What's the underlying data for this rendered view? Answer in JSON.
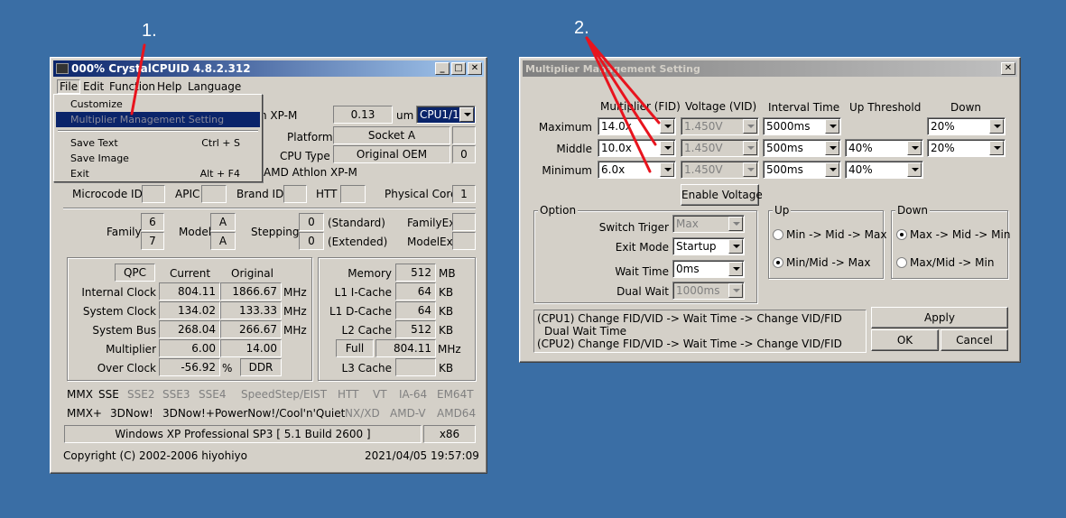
{
  "annotations": {
    "step1": "1.",
    "step2": "2."
  },
  "crystalcpuid": {
    "title": "000% CrystalCPUID 4.8.2.312",
    "menubar": [
      "File",
      "Edit",
      "Function",
      "Help",
      "Language"
    ],
    "file_menu": {
      "customize": "Customize",
      "multiplier": "Multiplier Management Setting",
      "save_text": "Save Text",
      "save_text_sc": "Ctrl + S",
      "save_image": "Save Image",
      "exit": "Exit",
      "exit_sc": "Alt + F4"
    },
    "name_partial": "n XP-M",
    "ghz": "0.13",
    "um": "um",
    "cpu_select": "CPU1/1",
    "platform_label": "Platform",
    "platform": "Socket A",
    "cputype_label": "CPU Type",
    "cputype": "Original OEM",
    "cputype_num": "0",
    "cpu_name": "AMD Athlon XP-M",
    "microcode_label": "Microcode ID",
    "apic_label": "APIC",
    "brand_label": "Brand ID",
    "htt_label": "HTT",
    "physcore_label": "Physical Core",
    "physcore": "1",
    "family_label": "Family",
    "family": "6",
    "family2": "7",
    "model_label": "Model",
    "model": "A",
    "model2": "A",
    "stepping_label": "Stepping",
    "stepping": "0",
    "stepping2": "0",
    "standard": "(Standard)",
    "extended": "(Extended)",
    "familyex_label": "FamilyEx",
    "modelex_label": "ModelEx",
    "clock": {
      "qpc": "QPC",
      "current": "Current",
      "original": "Original",
      "rows": [
        {
          "label": "Internal Clock",
          "cur": "804.11",
          "orig": "1866.67",
          "unit": "MHz"
        },
        {
          "label": "System Clock",
          "cur": "134.02",
          "orig": "133.33",
          "unit": "MHz"
        },
        {
          "label": "System Bus",
          "cur": "268.04",
          "orig": "266.67",
          "unit": "MHz"
        },
        {
          "label": "Multiplier",
          "cur": "6.00",
          "orig": "14.00",
          "unit": ""
        },
        {
          "label": "Over Clock",
          "cur": "-56.92",
          "orig": "DDR",
          "unit": "%"
        }
      ]
    },
    "memory": {
      "memory_label": "Memory",
      "memory": "512",
      "memory_unit": "MB",
      "l1i_label": "L1 I-Cache",
      "l1i": "64",
      "l1i_unit": "KB",
      "l1d_label": "L1 D-Cache",
      "l1d": "64",
      "l1d_unit": "KB",
      "l2_label": "L2 Cache",
      "l2": "512",
      "l2_unit": "KB",
      "full": "Full",
      "full_val": "804.11",
      "full_unit": "MHz",
      "l3_label": "L3 Cache",
      "l3_unit": "KB"
    },
    "features1": [
      "MMX",
      "SSE",
      "SSE2",
      "SSE3",
      "SSE4",
      "SpeedStep/EIST",
      "HTT",
      "VT",
      "IA-64",
      "EM64T"
    ],
    "features2": [
      "MMX+",
      "3DNow!",
      "3DNow!+",
      "PowerNow!/Cool'n'Quiet",
      "NX/XD",
      "AMD-V",
      "AMD64"
    ],
    "os": "Windows XP Professional SP3 [ 5.1 Build 2600 ]",
    "arch": "x86",
    "copyright": "Copyright (C) 2002-2006 hiyohiyo",
    "datetime": "2021/04/05 19:57:09"
  },
  "mms": {
    "title": "Multiplier Management Setting",
    "col_fid": "Multiplier (FID)",
    "col_vid": "Voltage (VID)",
    "col_interval": "Interval Time",
    "col_up": "Up Threshold",
    "col_down": "Down",
    "rows": [
      {
        "label": "Maximum",
        "fid": "14.0x",
        "vid": "1.450V",
        "interval": "5000ms",
        "up": "",
        "down": "20%"
      },
      {
        "label": "Middle",
        "fid": "10.0x",
        "vid": "1.450V",
        "interval": "500ms",
        "up": "40%",
        "down": "20%"
      },
      {
        "label": "Minimum",
        "fid": "6.0x",
        "vid": "1.450V",
        "interval": "500ms",
        "up": "40%",
        "down": ""
      }
    ],
    "enable_voltage": "Enable Voltage",
    "option_label": "Option",
    "switch_label": "Switch Triger",
    "switch": "Max",
    "exit_label": "Exit Mode",
    "exit": "Startup",
    "wait_label": "Wait Time",
    "wait": "0ms",
    "dual_label": "Dual Wait",
    "dual": "1000ms",
    "up_group": "Up",
    "up_opt1": "Min -> Mid -> Max",
    "up_opt2": "Min/Mid -> Max",
    "down_group": "Down",
    "down_opt1": "Max -> Mid -> Min",
    "down_opt2": "Max/Mid -> Min",
    "info1": "(CPU1) Change FID/VID -> Wait Time -> Change VID/FID",
    "info2": "Dual Wait Time",
    "info3": "(CPU2) Change FID/VID -> Wait Time -> Change VID/FID",
    "apply": "Apply",
    "ok": "OK",
    "cancel": "Cancel"
  },
  "colors": {
    "desktop": "#3a6ea5",
    "title_active": "#0a246a",
    "annotation": "#e8141e"
  }
}
